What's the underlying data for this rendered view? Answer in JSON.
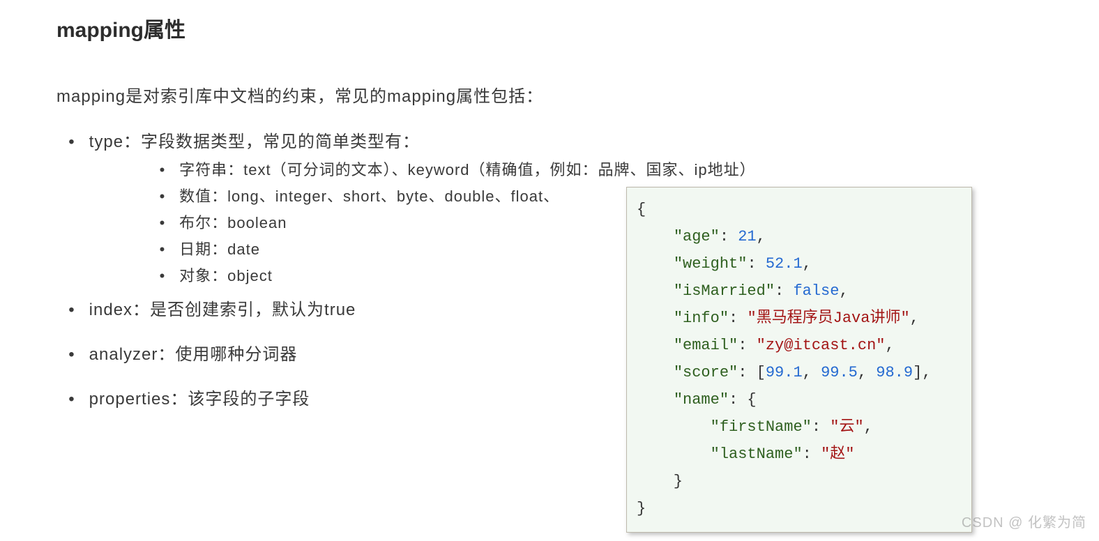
{
  "heading": "mapping属性",
  "intro": "mapping是对索引库中文档的约束，常见的mapping属性包括：",
  "bullets": {
    "type": "type：字段数据类型，常见的简单类型有：",
    "type_subs": {
      "string": "字符串：text（可分词的文本）、keyword（精确值，例如：品牌、国家、ip地址）",
      "number": "数值：long、integer、short、byte、double、float、",
      "bool": "布尔：boolean",
      "date": "日期：date",
      "object": "对象：object"
    },
    "index": "index：是否创建索引，默认为true",
    "analyzer": "analyzer：使用哪种分词器",
    "properties": "properties：该字段的子字段"
  },
  "code": {
    "open": "{",
    "age_key": "\"age\"",
    "age_val": "21",
    "weight_key": "\"weight\"",
    "weight_val": "52.1",
    "married_key": "\"isMarried\"",
    "married_val": "false",
    "info_key": "\"info\"",
    "info_val": "\"黑马程序员Java讲师\"",
    "email_key": "\"email\"",
    "email_val": "\"zy@itcast.cn\"",
    "score_key": "\"score\"",
    "score_vals": [
      "99.1",
      "99.5",
      "98.9"
    ],
    "name_key": "\"name\"",
    "first_key": "\"firstName\"",
    "first_val": "\"云\"",
    "last_key": "\"lastName\"",
    "last_val": "\"赵\"",
    "close_inner": "    }",
    "close": "}"
  },
  "watermark": "CSDN @ 化繁为简"
}
